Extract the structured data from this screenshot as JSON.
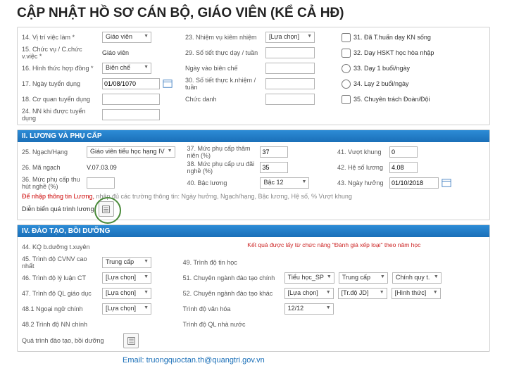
{
  "title": "CẬP NHẬT HỒ SƠ CÁN BỘ, GIÁO VIÊN (KỂ CẢ HĐ)",
  "sec1": {
    "r14": {
      "lbl": "14. Vị trí việc làm *",
      "val": "Giáo viên"
    },
    "r15": {
      "lbl": "15. Chức vụ / C.chức v.việc *",
      "val": "Giáo viên"
    },
    "r16": {
      "lbl": "16. Hình thức hợp đồng *",
      "val": "Biên chế"
    },
    "r17": {
      "lbl": "17. Ngày tuyển dụng",
      "val": "01/08/1070"
    },
    "r18": {
      "lbl": "18. Cơ quan tuyển dụng"
    },
    "r24": {
      "lbl": "24. NN khi được tuyển dụng"
    },
    "r23": {
      "lbl": "23. Nhiệm vụ kiêm nhiệm",
      "val": "[Lựa chọn]"
    },
    "r29": {
      "lbl": "29. Số tiết thực dạy / tuần"
    },
    "rNgayBC": {
      "lbl": "Ngày vào biên chế"
    },
    "r30": {
      "lbl": "30. Số tiết thực k.nhiệm / tuần"
    },
    "rChucDanh": {
      "lbl": "Chức danh"
    },
    "r31": {
      "lbl": "31. Đã T.huấn dạy KN sống"
    },
    "r32": {
      "lbl": "32. Dạy HSKT học hòa nhập"
    },
    "r33": {
      "lbl": "33. Dạy 1 buổi/ngày"
    },
    "r34": {
      "lbl": "34. Lạy 2 buổi/ngày"
    },
    "r35": {
      "lbl": "35. Chuyên trách Đoàn/Đội"
    }
  },
  "sec2": {
    "header": "II. LƯƠNG VÀ PHỤ CẤP",
    "r25": {
      "lbl": "25. Ngạch/Hạng",
      "val": "Giáo viên tiểu học hạng IV"
    },
    "r26": {
      "lbl": "26. Mã ngạch",
      "val": "V.07.03.09"
    },
    "r36": {
      "lbl": "36. Mức phụ cấp thu hút nghề (%)"
    },
    "r37": {
      "lbl": "37. Mức phụ cấp thâm niên (%)",
      "val": "37"
    },
    "r38": {
      "lbl": "38. Mức phụ cấp ưu đãi nghề (%)",
      "val": "35"
    },
    "r40": {
      "lbl": "40. Bậc lương",
      "val": "Bậc 12"
    },
    "r41": {
      "lbl": "41. Vượt khung",
      "val": "0"
    },
    "r42": {
      "lbl": "42. Hệ số lương",
      "val": "4.08"
    },
    "r43": {
      "lbl": "43. Ngày hưởng",
      "val": "01/10/2018"
    },
    "note": {
      "left": "Để nhập thông tin Lương, ",
      "right": "nhập đủ các trường thông tin: Ngày hưởng, Ngạch/hạng, Bậc lương, Hệ số, % Vượt khung"
    },
    "detailLbl": "Diễn biến quá trình lương"
  },
  "sec3": {
    "header": "IV. ĐÀO TẠO, BỒI DƯỠNG",
    "note": "Kết quả được lấy từ chức năng \"Đánh giá xếp loại\" theo năm học",
    "r44": {
      "lbl": "44. KQ b.dưỡng t.xuyên"
    },
    "r45": {
      "lbl": "45. Trình độ CVNV cao nhất",
      "val": "Trung cấp"
    },
    "r46": {
      "lbl": "46. Trình độ lý luận CT",
      "val": "[Lựa chọn]"
    },
    "r47": {
      "lbl": "47. Trình độ QL giáo dục",
      "val": "[Lựa chọn]"
    },
    "r481": {
      "lbl": "48.1 Ngoại ngữ chính",
      "val": "[Lựa chọn]"
    },
    "r482": {
      "lbl": "48.2 Trình độ NN chính"
    },
    "r49": {
      "lbl": "49. Trình độ tin học"
    },
    "r51": {
      "lbl": "51. Chuyên ngành đào tạo chính",
      "v1": "Tiểu học_SP",
      "v2": "Trung cấp",
      "v3": "Chính quy t."
    },
    "r52": {
      "lbl": "52. Chuyên ngành đào tạo khác",
      "v1": "[Lựa chọn]",
      "v2": "[Tr.độ JD]",
      "v3": "[Hình thức]"
    },
    "rVH": {
      "lbl": "Trình độ văn hóa",
      "val": "12/12"
    },
    "rQLNN": {
      "lbl": "Trình độ QL nhà nước"
    },
    "rQuaTrinh": {
      "lbl": "Quá trình đào tạo, bồi dưỡng"
    }
  },
  "footer": {
    "email": "Email: truongquoctan.th@quangtri.gov.vn"
  }
}
